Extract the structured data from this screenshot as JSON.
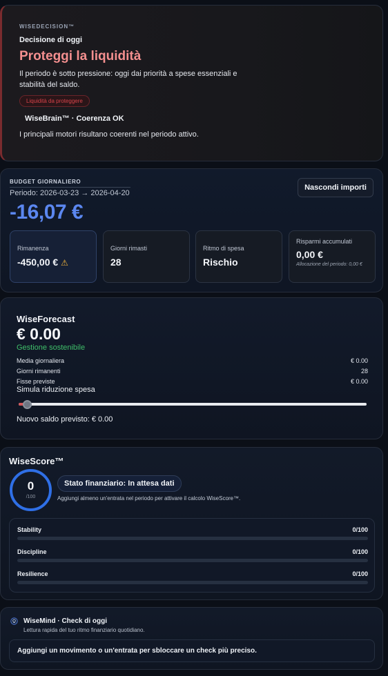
{
  "decision": {
    "brand": "WISEDECISION™",
    "label": "Decisione di oggi",
    "title": "Proteggi la liquidità",
    "description": "Il periodo è sotto pressione: oggi dai priorità a spese essenziali e stabilità del saldo.",
    "badge": "Liquidità da proteggere",
    "brain_status": "WiseBrain™ · Coerenza OK",
    "brain_description": "I principali motori risultano coerenti nel periodo attivo.",
    "accent_color": "#f48f8f"
  },
  "budget": {
    "heading": "BUDGET GIORNALIERO",
    "period": "Periodo: 2026-03-23 → 2026-04-20",
    "daily_amount": "-16,07 €",
    "hide_button": "Nascondi importi",
    "amount_color": "#5b87f0",
    "tiles": [
      {
        "label": "Rimanenza",
        "value": "-450,00 €",
        "icon": "warning-icon"
      },
      {
        "label": "Giorni rimasti",
        "value": "28"
      },
      {
        "label": "Ritmo di spesa",
        "value": "Rischio"
      },
      {
        "label": "Risparmi accumulati",
        "value": "0,00 €",
        "note": "Allocazione del periodo: 0,00 €"
      }
    ]
  },
  "forecast": {
    "title": "WiseForecast",
    "amount": "€ 0.00",
    "status": "Gestione sostenibile",
    "status_color": "#3fbf6a",
    "rows": [
      {
        "label": "Media giornaliera",
        "value": "€ 0.00"
      },
      {
        "label": "Giorni rimanenti",
        "value": "28"
      },
      {
        "label": "Fisse previste",
        "value": "€ 0.00"
      }
    ],
    "simulate_label": "Simula riduzione spesa",
    "slider_fraction": 0.02,
    "new_balance": "Nuovo saldo previsto: € 0.00"
  },
  "score": {
    "title": "WiseScore™",
    "value": "0",
    "max": "/100",
    "status": "Stato finanziario: In attesa dati",
    "description": "Aggiungi almeno un'entrata nel periodo per attivare il calcolo WiseScore™.",
    "ring_color": "#2f6fe6",
    "metrics": [
      {
        "label": "Stability",
        "value": "0/100",
        "fraction": 0
      },
      {
        "label": "Discipline",
        "value": "0/100",
        "fraction": 0
      },
      {
        "label": "Resilience",
        "value": "0/100",
        "fraction": 0
      }
    ]
  },
  "wisemind": {
    "icon": "lightbulb-icon",
    "title": "WiseMind · Check di oggi",
    "subtitle": "Lettura rapida del tuo ritmo finanziario quotidiano.",
    "message": "Aggiungi un movimento o un'entrata per sbloccare un check più preciso."
  }
}
